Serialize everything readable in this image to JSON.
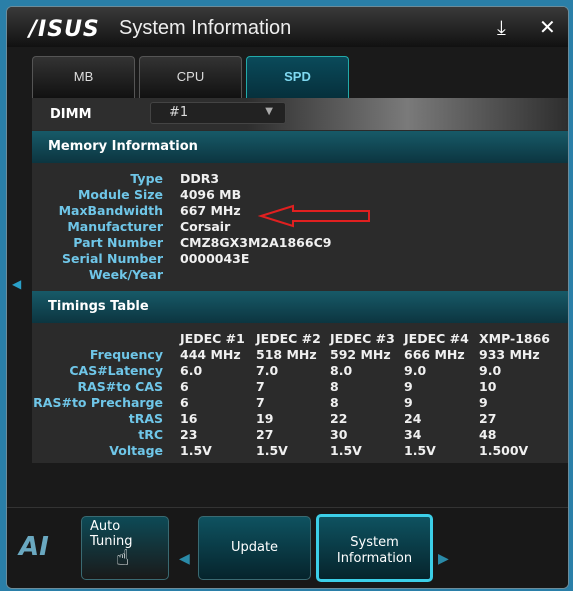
{
  "window": {
    "logo": "/ISUS",
    "title": "System Information",
    "minimize_icon": "download-icon",
    "close_icon": "close-icon"
  },
  "tabs": [
    {
      "label": "MB"
    },
    {
      "label": "CPU"
    },
    {
      "label": "SPD",
      "active": true
    }
  ],
  "dimm": {
    "label": "DIMM",
    "selected": "#1"
  },
  "memory": {
    "header": "Memory Information",
    "rows": [
      {
        "label": "Type",
        "value": "DDR3"
      },
      {
        "label": "Module Size",
        "value": "4096 MB"
      },
      {
        "label": "MaxBandwidth",
        "value": "667 MHz"
      },
      {
        "label": "Manufacturer",
        "value": "Corsair"
      },
      {
        "label": "Part Number",
        "value": "CMZ8GX3M2A1866C9"
      },
      {
        "label": "Serial Number",
        "value": "0000043E"
      },
      {
        "label": "Week/Year",
        "value": ""
      }
    ]
  },
  "timings": {
    "header": "Timings Table",
    "columns": [
      "JEDEC #1",
      "JEDEC #2",
      "JEDEC #3",
      "JEDEC #4",
      "XMP-1866"
    ],
    "rows": [
      {
        "label": "Frequency",
        "values": [
          "444 MHz",
          "518 MHz",
          "592 MHz",
          "666 MHz",
          "933 MHz"
        ]
      },
      {
        "label": "CAS#Latency",
        "values": [
          "6.0",
          "7.0",
          "8.0",
          "9.0",
          "9.0"
        ]
      },
      {
        "label": "RAS#to CAS",
        "values": [
          "6",
          "7",
          "8",
          "9",
          "10"
        ]
      },
      {
        "label": "RAS#to Precharge",
        "values": [
          "6",
          "7",
          "8",
          "9",
          "9"
        ]
      },
      {
        "label": "tRAS",
        "values": [
          "16",
          "19",
          "22",
          "24",
          "27"
        ]
      },
      {
        "label": "tRC",
        "values": [
          "23",
          "27",
          "30",
          "34",
          "48"
        ]
      },
      {
        "label": "Voltage",
        "values": [
          "1.5V",
          "1.5V",
          "1.5V",
          "1.5V",
          "1.500V"
        ]
      }
    ]
  },
  "bottom": {
    "logo": "AI",
    "auto_tuning": "Auto Tuning",
    "update": "Update",
    "system_information": "System Information"
  },
  "colors": {
    "accent": "#6fc6e8",
    "annotation_arrow": "#e02020"
  }
}
